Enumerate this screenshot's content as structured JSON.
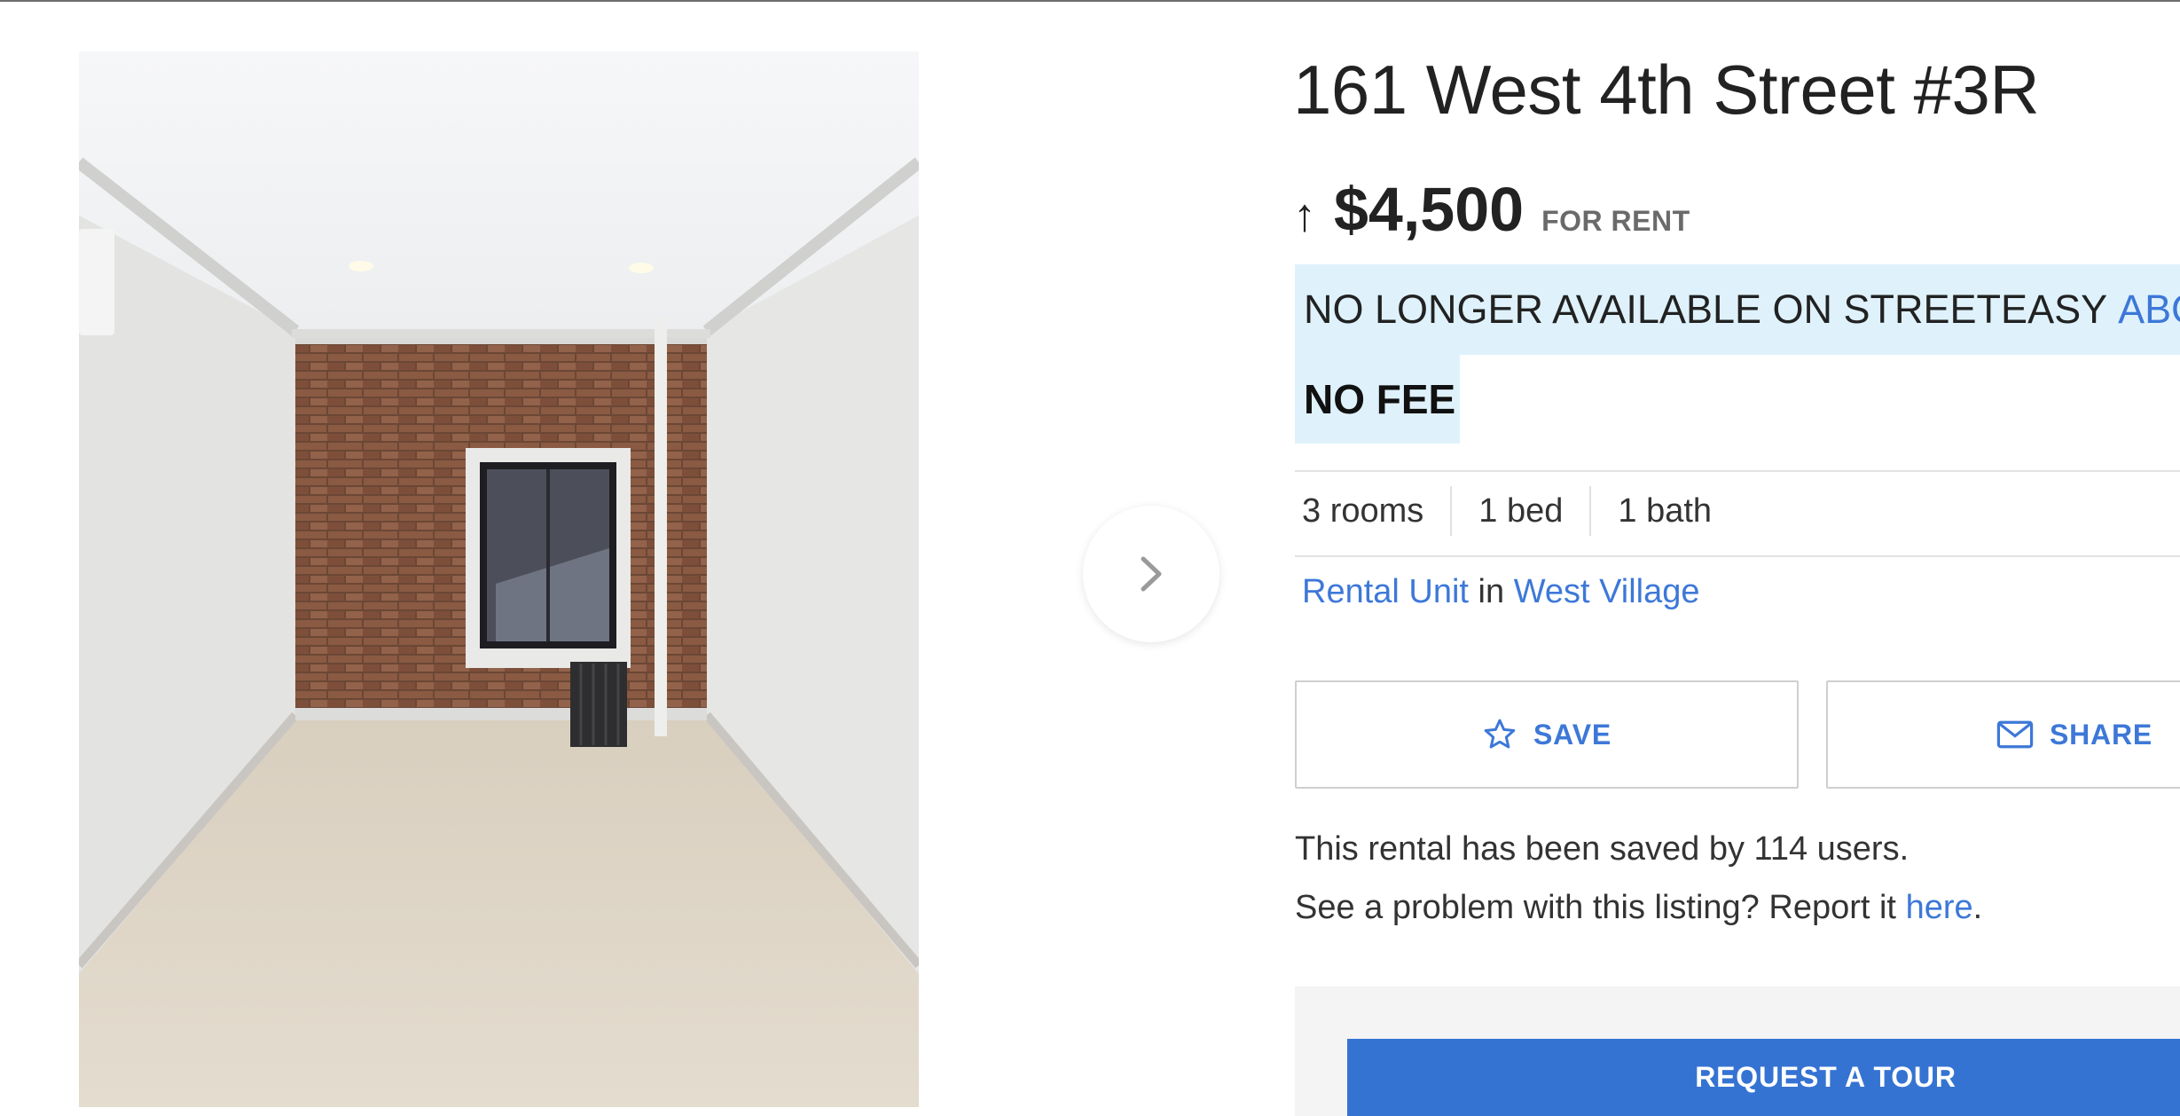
{
  "listing": {
    "title": "161 West 4th Street #3R",
    "price_change_icon": "arrow-up-icon",
    "price": "$4,500",
    "price_label": "FOR RENT",
    "status": "NO LONGER AVAILABLE ON STREETEASY",
    "status_link": "ABO",
    "fee": "NO FEE"
  },
  "details": {
    "rooms": "3 rooms",
    "beds": "1 bed",
    "baths": "1 bath"
  },
  "location": {
    "type_link": "Rental Unit",
    "connector": "in",
    "neighborhood_link": "West Village"
  },
  "actions": {
    "save_label": "SAVE",
    "save_icon": "star-outline-icon",
    "share_label": "SHARE",
    "share_icon": "envelope-icon"
  },
  "info": {
    "saved_text": "This rental has been saved by 114 users.",
    "report_prefix": "See a problem with this listing? Report it",
    "report_link": "here",
    "report_suffix": "."
  },
  "cta": {
    "request_tour_label": "REQUEST A TOUR"
  },
  "gallery": {
    "next_icon": "chevron-right-icon"
  },
  "colors": {
    "link_blue": "#3d78d8",
    "status_highlight": "#dff2fc",
    "primary_button": "#3573d3"
  }
}
